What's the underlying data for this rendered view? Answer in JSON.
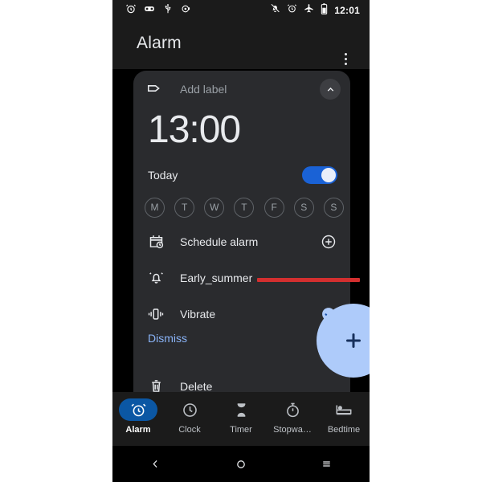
{
  "statusbar": {
    "left_icons": [
      "alarm-icon",
      "voicemail-icon",
      "usb-icon",
      "notification-dot-icon"
    ],
    "right_icons": [
      "bell-off-icon",
      "alarm-icon",
      "airplane-mode-icon",
      "battery-icon"
    ],
    "clock": "12:01"
  },
  "appbar": {
    "title": "Alarm",
    "overflow_name": "overflow-menu-icon"
  },
  "alarm_card": {
    "label_placeholder": "Add label",
    "time": "13:00",
    "repeat_label": "Today",
    "switch_on": true,
    "days": [
      {
        "letter": "M",
        "selected": false
      },
      {
        "letter": "T",
        "selected": false
      },
      {
        "letter": "W",
        "selected": false
      },
      {
        "letter": "T",
        "selected": false
      },
      {
        "letter": "F",
        "selected": false
      },
      {
        "letter": "S",
        "selected": false
      },
      {
        "letter": "S",
        "selected": false
      }
    ],
    "schedule_label": "Schedule alarm",
    "ringtone_label": "Early_summer",
    "vibrate_label": "Vibrate",
    "vibrate_checked": true,
    "dismiss_label": "Dismiss",
    "delete_label": "Delete"
  },
  "fab": {
    "name": "add-alarm-fab",
    "glyph": "+"
  },
  "bottomnav": {
    "items": [
      {
        "label": "Alarm",
        "icon": "alarm-icon",
        "active": true
      },
      {
        "label": "Clock",
        "icon": "clock-icon",
        "active": false
      },
      {
        "label": "Timer",
        "icon": "hourglass-icon",
        "active": false
      },
      {
        "label": "Stopwa…",
        "icon": "stopwatch-icon",
        "active": false
      },
      {
        "label": "Bedtime",
        "icon": "bed-icon",
        "active": false
      }
    ]
  },
  "sysnav": {
    "back": "back-icon",
    "home": "home-icon",
    "recents": "recents-icon"
  },
  "colors": {
    "accent_blue": "#1a62d6",
    "fab_blue": "#aecbfa",
    "link_blue": "#8ab4f8",
    "annotation_red": "#d32f2f",
    "card_bg": "#2a2b2e",
    "screen_bg": "#1b1b1b"
  }
}
